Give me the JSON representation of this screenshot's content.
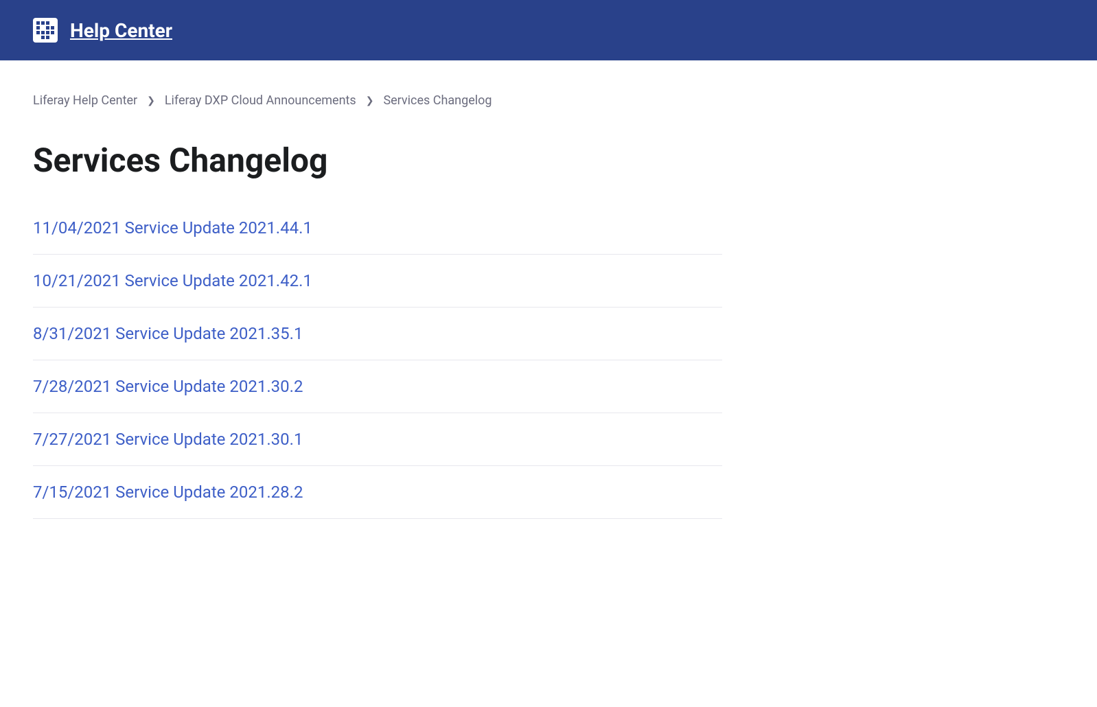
{
  "header": {
    "title": "Help Center"
  },
  "breadcrumb": {
    "items": [
      {
        "label": "Liferay Help Center"
      },
      {
        "label": "Liferay DXP Cloud Announcements"
      },
      {
        "label": "Services Changelog"
      }
    ]
  },
  "page": {
    "title": "Services Changelog"
  },
  "articles": [
    {
      "title": "11/04/2021 Service Update 2021.44.1"
    },
    {
      "title": "10/21/2021 Service Update 2021.42.1"
    },
    {
      "title": "8/31/2021 Service Update 2021.35.1"
    },
    {
      "title": "7/28/2021 Service Update 2021.30.2"
    },
    {
      "title": "7/27/2021 Service Update 2021.30.1"
    },
    {
      "title": "7/15/2021 Service Update 2021.28.2"
    }
  ]
}
